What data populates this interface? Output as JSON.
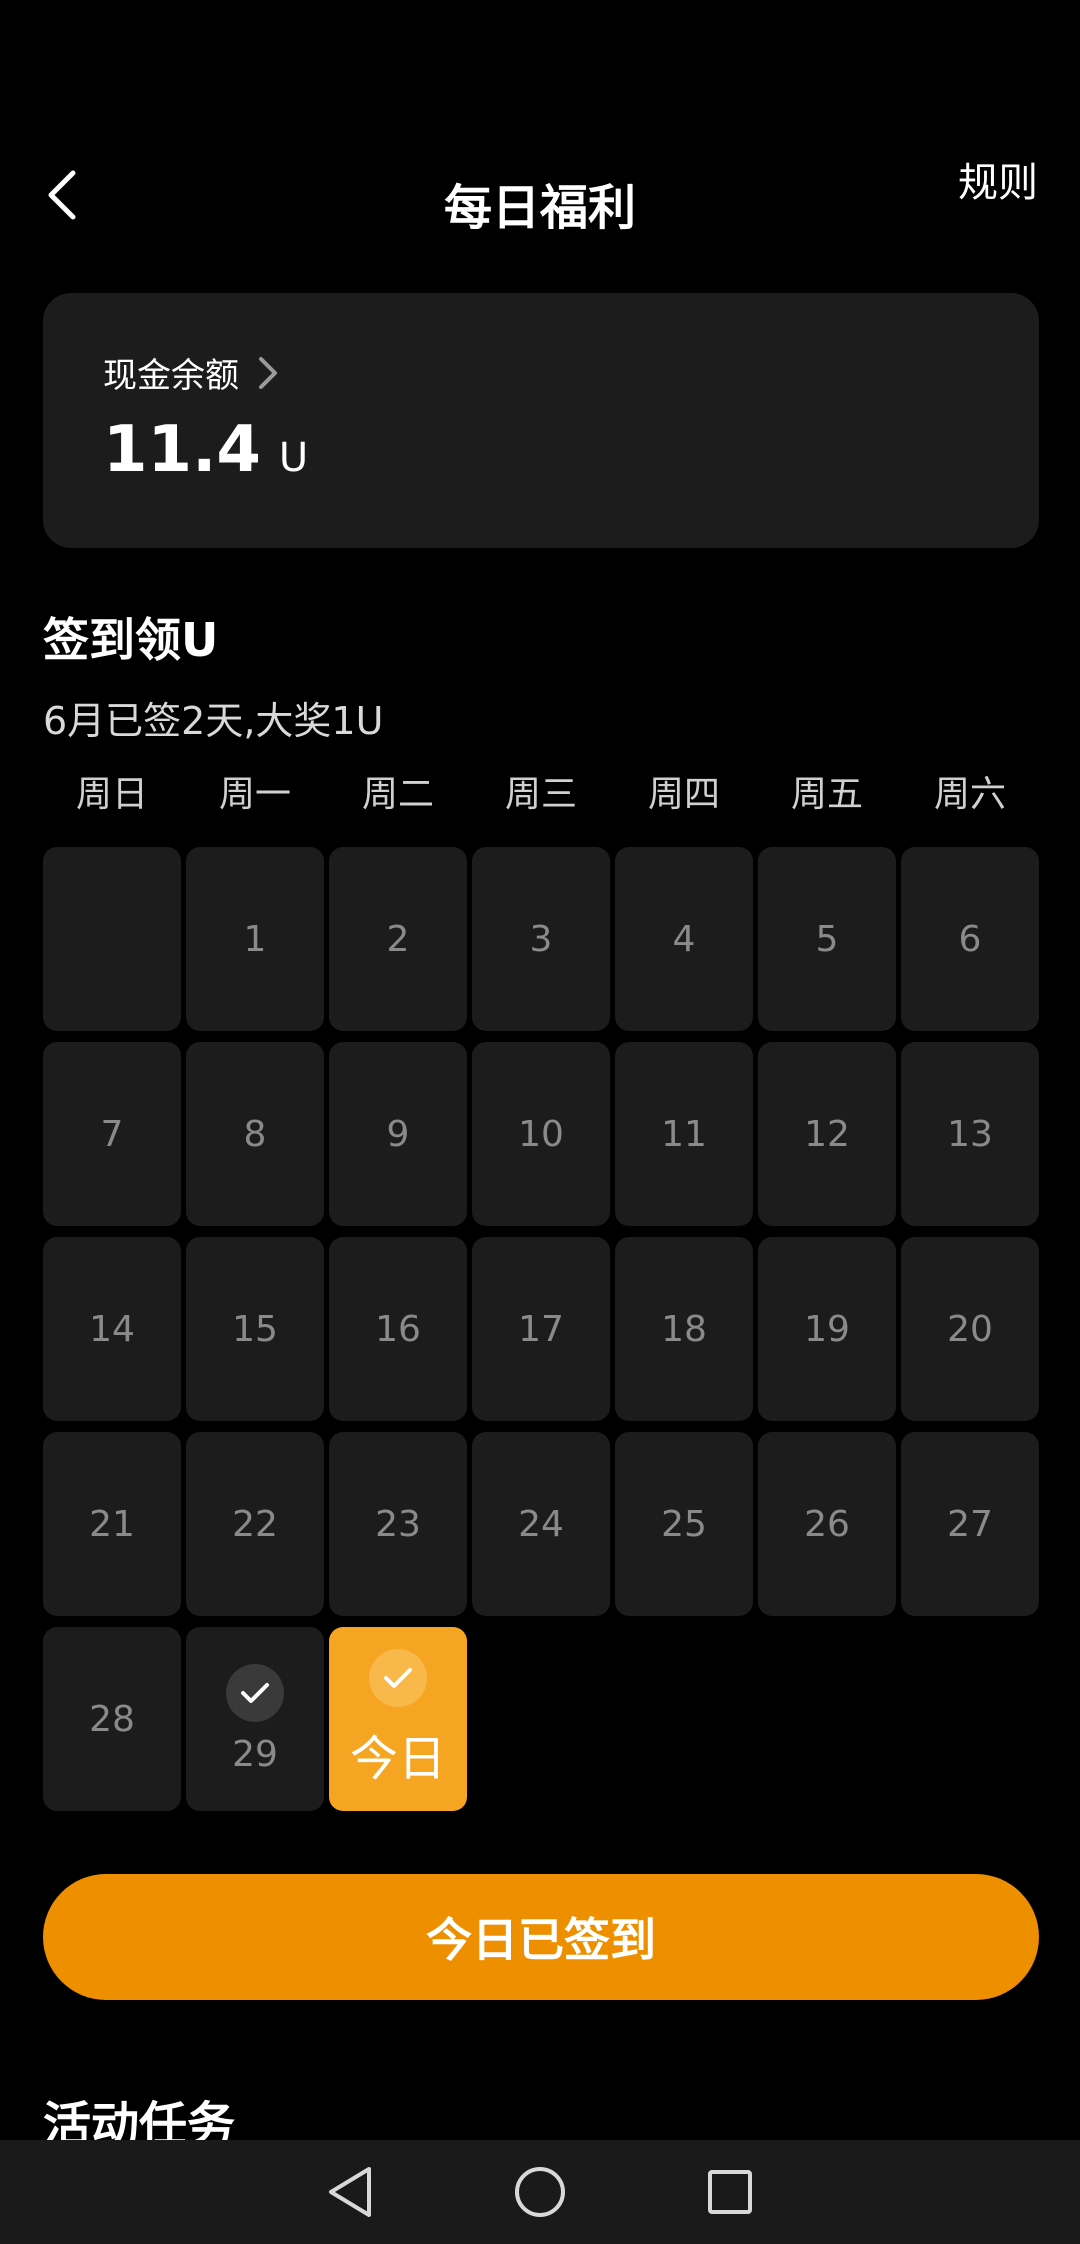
{
  "header": {
    "title": "每日福利",
    "rules_label": "规则"
  },
  "balance": {
    "label": "现金余额",
    "value": "11.4",
    "unit": "U"
  },
  "signin": {
    "title": "签到领U",
    "summary": "6月已签2天,大奖1U",
    "weekdays": [
      "周日",
      "周一",
      "周二",
      "周三",
      "周四",
      "周五",
      "周六"
    ],
    "days": [
      {
        "label": "",
        "state": "empty"
      },
      {
        "label": "1",
        "state": "normal"
      },
      {
        "label": "2",
        "state": "normal"
      },
      {
        "label": "3",
        "state": "normal"
      },
      {
        "label": "4",
        "state": "normal"
      },
      {
        "label": "5",
        "state": "normal"
      },
      {
        "label": "6",
        "state": "normal"
      },
      {
        "label": "7",
        "state": "normal"
      },
      {
        "label": "8",
        "state": "normal"
      },
      {
        "label": "9",
        "state": "normal"
      },
      {
        "label": "10",
        "state": "normal"
      },
      {
        "label": "11",
        "state": "normal"
      },
      {
        "label": "12",
        "state": "normal"
      },
      {
        "label": "13",
        "state": "normal"
      },
      {
        "label": "14",
        "state": "normal"
      },
      {
        "label": "15",
        "state": "normal"
      },
      {
        "label": "16",
        "state": "normal"
      },
      {
        "label": "17",
        "state": "normal"
      },
      {
        "label": "18",
        "state": "normal"
      },
      {
        "label": "19",
        "state": "normal"
      },
      {
        "label": "20",
        "state": "normal"
      },
      {
        "label": "21",
        "state": "normal"
      },
      {
        "label": "22",
        "state": "normal"
      },
      {
        "label": "23",
        "state": "normal"
      },
      {
        "label": "24",
        "state": "normal"
      },
      {
        "label": "25",
        "state": "normal"
      },
      {
        "label": "26",
        "state": "normal"
      },
      {
        "label": "27",
        "state": "normal"
      },
      {
        "label": "28",
        "state": "normal"
      },
      {
        "label": "29",
        "state": "checked"
      },
      {
        "label": "今日",
        "state": "today"
      }
    ],
    "button_label": "今日已签到"
  },
  "tasks": {
    "title": "活动任务"
  },
  "icons": {
    "back": "chevron-left-icon",
    "balance_arrow": "chevron-right-icon",
    "check": "check-icon",
    "nav_back": "triangle-back-icon",
    "nav_home": "circle-home-icon",
    "nav_recents": "square-recents-icon"
  },
  "colors": {
    "accent": "#ee8f00",
    "today_cell": "#f5a521",
    "card": "#1c1c1c",
    "background": "#000000"
  }
}
